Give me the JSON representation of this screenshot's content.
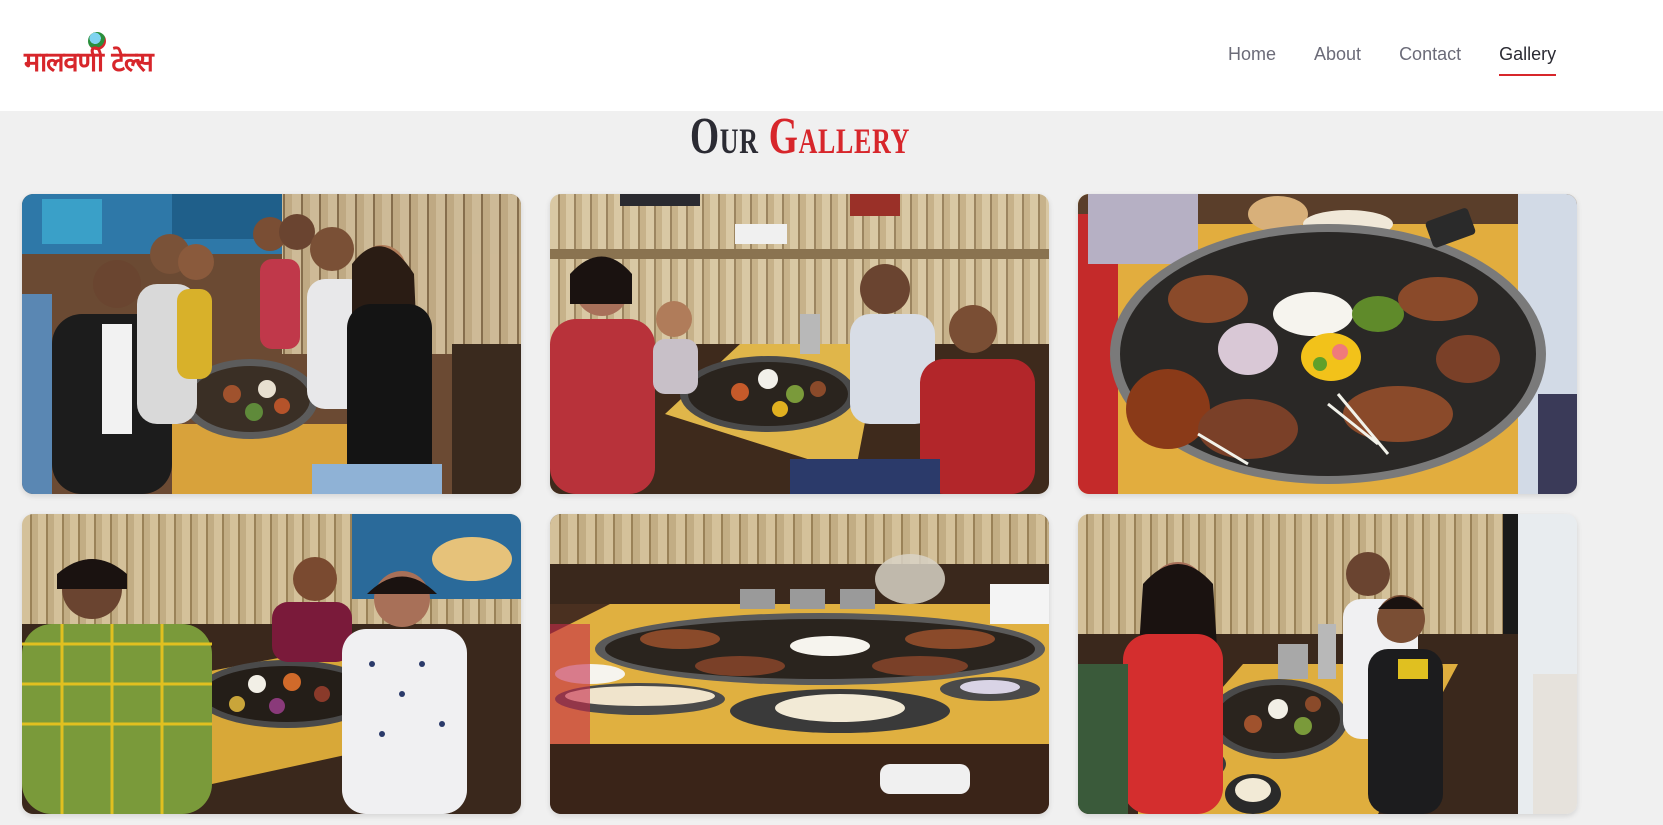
{
  "brand": {
    "logo_text": "मालवणी टेल्स"
  },
  "nav": {
    "items": [
      {
        "label": "Home",
        "active": false
      },
      {
        "label": "About",
        "active": false
      },
      {
        "label": "Contact",
        "active": false
      },
      {
        "label": "Gallery",
        "active": true
      }
    ]
  },
  "gallery": {
    "title_part1": "Our",
    "title_part2": "Gallery",
    "photos": [
      {
        "subject": "group of friends at table with thali"
      },
      {
        "subject": "family of four with thali"
      },
      {
        "subject": "close-up of seafood thali platter"
      },
      {
        "subject": "three friends with thali near aquarium mural"
      },
      {
        "subject": "large thali platters on table"
      },
      {
        "subject": "family of three with thali"
      }
    ]
  },
  "colors": {
    "accent": "#d7262b",
    "background": "#f0f0f0",
    "nav_text": "#6b6b78"
  }
}
